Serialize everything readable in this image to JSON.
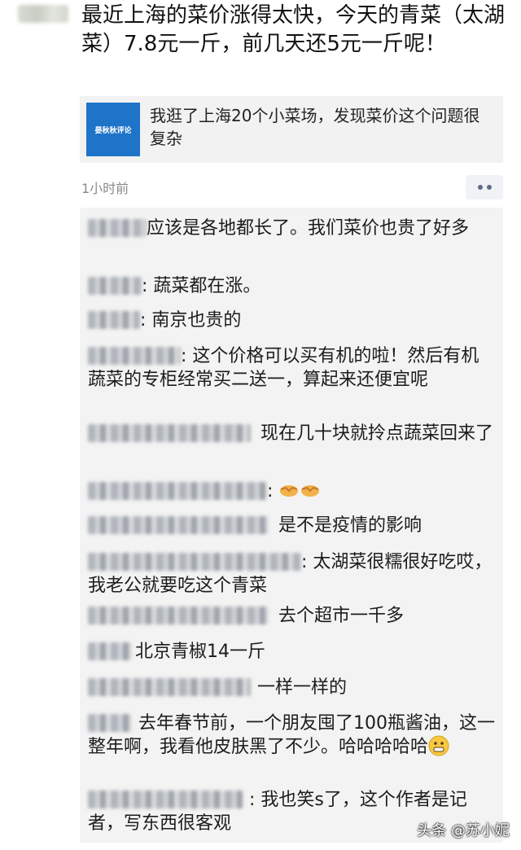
{
  "post": {
    "text": "最近上海的菜价涨得太快，今天的青菜（太湖菜）7.8元一斤，前几天还5元一斤呢！",
    "link_card": {
      "thumb_text": "晏秋秋评论",
      "title": "我逛了上海20个小菜场，发现菜价这个问题很复杂"
    },
    "time": "1小时前"
  },
  "comments": [
    {
      "text": "应该是各地都长了。我们菜价也贵了好多"
    },
    {
      "text": ": 蔬菜都在涨。"
    },
    {
      "text": ": 南京也贵的"
    },
    {
      "text": ": 这个价格可以买有机的啦！然后有机蔬菜的专柜经常买二送一，算起来还便宜呢"
    },
    {
      "text": "现在几十块就拎点蔬菜回来了"
    },
    {
      "text": ": "
    },
    {
      "text": "是不是疫情的影响"
    },
    {
      "text": ": 太湖菜很糯很好吃哎，我老公就要吃这个青菜"
    },
    {
      "text": "去个超市一千多"
    },
    {
      "text": "北京青椒14一斤"
    },
    {
      "text": "一样一样的"
    },
    {
      "text": "去年春节前，一个朋友囤了100瓶酱油，这一整年啊，我看他皮肤黑了不少。哈哈哈哈哈"
    },
    {
      "text": ": 我也笑s了，这个作者是记者，写东西很客观"
    }
  ],
  "icons": {
    "handshake": "handshake-emoji",
    "grin": "grimacing-emoji",
    "more": "more-dots-icon"
  },
  "watermark": "头条 @苏小妮"
}
